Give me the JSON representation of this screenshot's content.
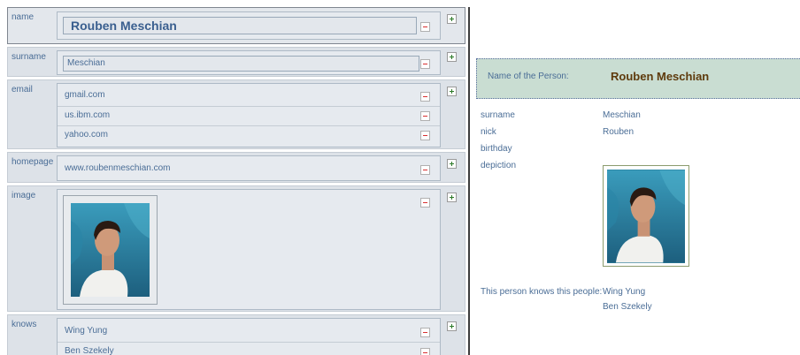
{
  "editor": {
    "name": {
      "label": "name",
      "value": "Rouben Meschian"
    },
    "surname": {
      "label": "surname",
      "value": "Meschian"
    },
    "email": {
      "label": "email",
      "values": [
        "gmail.com",
        "us.ibm.com",
        "yahoo.com"
      ]
    },
    "homepage": {
      "label": "homepage",
      "value": "www.roubenmeschian.com"
    },
    "image": {
      "label": "image"
    },
    "knows": {
      "label": "knows",
      "values": [
        "Wing Yung",
        "Ben Szekely"
      ]
    }
  },
  "viewer": {
    "banner_label": "Name of the Person:",
    "banner_value": "Rouben Meschian",
    "properties": [
      {
        "label": "surname",
        "value": "Meschian"
      },
      {
        "label": "nick",
        "value": "Rouben"
      },
      {
        "label": "birthday",
        "value": ""
      },
      {
        "label": "depiction",
        "value": ""
      }
    ],
    "knows_label": "This person knows this people:",
    "knows_values": [
      "Wing Yung",
      "Ben Szekely"
    ]
  },
  "icons": {
    "remove": "minus-icon",
    "add": "plus-icon"
  },
  "colors": {
    "label_text": "#4a6d96",
    "panel_bg": "#dde2e8",
    "banner_bg": "#c9ddd2",
    "banner_name": "#5e3a0c",
    "remove_red": "#d83030",
    "add_green": "#2c7a28"
  }
}
